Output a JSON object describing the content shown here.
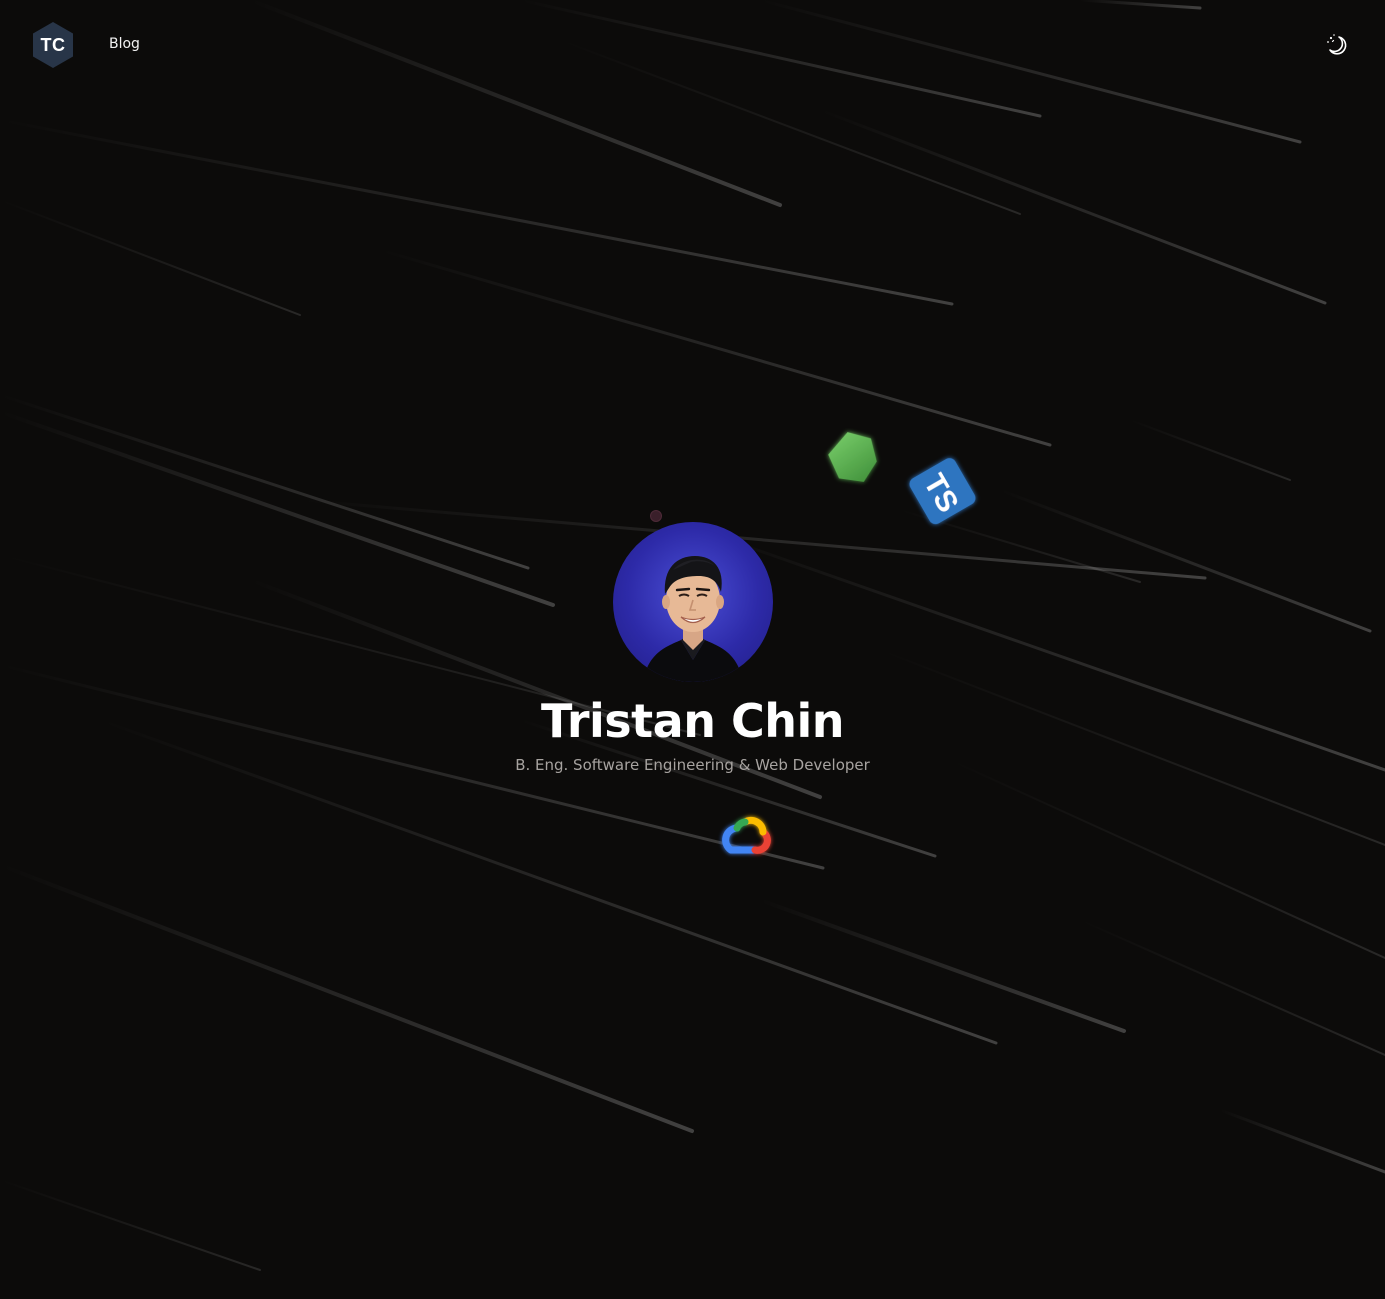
{
  "header": {
    "logo_text": "TC",
    "nav": [
      {
        "label": "Blog"
      }
    ],
    "theme_toggle_icon": "moon-stars-icon"
  },
  "hero": {
    "name": "Tristan Chin",
    "subtitle": "B. Eng. Software Engineering & Web Developer",
    "avatar_icon": "profile-photo",
    "floating_icons": [
      "green-gem-icon",
      "typescript-icon",
      "google-cloud-icon",
      "dot-icon"
    ],
    "ts_label": "TS"
  },
  "colors": {
    "background": "#0c0b0a",
    "logo_bg": "#283548",
    "avatar_bg": "#2d2aa8",
    "ts_blue": "#2f74c0",
    "gem_green": "#5cb44e",
    "text_primary": "#ffffff",
    "text_secondary": "#a7a3a0"
  }
}
